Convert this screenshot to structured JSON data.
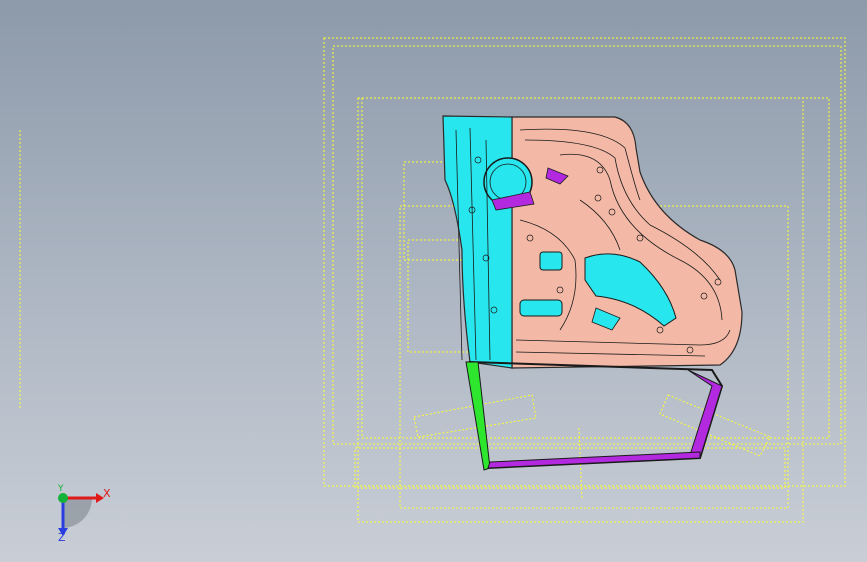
{
  "viewport": {
    "background_top": "#8d9aaa",
    "background_bottom": "#c9ced6"
  },
  "colors": {
    "bounding_box": "#ffff33",
    "panel_cyan": "#27e6ee",
    "panel_salmon": "#f3b9a6",
    "edge_green": "#2ee62e",
    "edge_purple": "#b329e0",
    "outline": "#1a1a1a"
  },
  "triad": {
    "x_label": "X",
    "y_label": "Y",
    "z_label": "Z",
    "x_color": "#e01818",
    "y_color": "#13b33a",
    "z_color": "#2a3de0"
  },
  "icons": {
    "triad": "coordinate-triad-icon"
  }
}
